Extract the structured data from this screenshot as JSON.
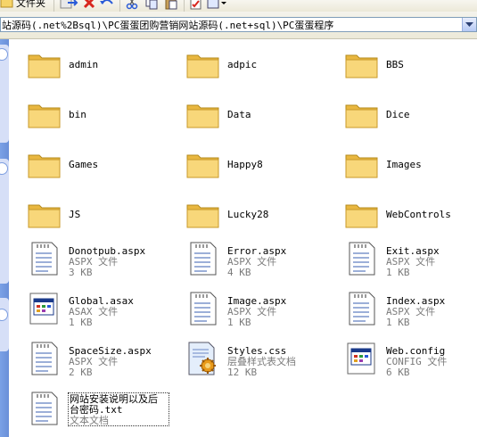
{
  "toolbar": {
    "folders_label": "文件夹"
  },
  "address": {
    "path": "站源码(.net%2Bsql)\\PC蛋蛋团购营销网站源码(.net+sql)\\PC蛋蛋程序"
  },
  "colors": {
    "folder_yellow": "#f6d46a",
    "selection": "#316ac5"
  },
  "folders": [
    {
      "name": "admin"
    },
    {
      "name": "adpic"
    },
    {
      "name": "BBS"
    },
    {
      "name": "bin"
    },
    {
      "name": "Data"
    },
    {
      "name": "Dice"
    },
    {
      "name": "Games"
    },
    {
      "name": "Happy8"
    },
    {
      "name": "Images"
    },
    {
      "name": "JS"
    },
    {
      "name": "Lucky28"
    },
    {
      "name": "WebControls"
    }
  ],
  "files": [
    {
      "name": "Donotpub.aspx",
      "type": "ASPX 文件",
      "size": "3 KB",
      "icon": "aspx-file-icon"
    },
    {
      "name": "Error.aspx",
      "type": "ASPX 文件",
      "size": "4 KB",
      "icon": "aspx-file-icon"
    },
    {
      "name": "Exit.aspx",
      "type": "ASPX 文件",
      "size": "1 KB",
      "icon": "aspx-file-icon"
    },
    {
      "name": "Global.asax",
      "type": "ASAX 文件",
      "size": "1 KB",
      "icon": "asax-file-icon"
    },
    {
      "name": "Image.aspx",
      "type": "ASPX 文件",
      "size": "1 KB",
      "icon": "aspx-file-icon"
    },
    {
      "name": "Index.aspx",
      "type": "ASPX 文件",
      "size": "1 KB",
      "icon": "aspx-file-icon"
    },
    {
      "name": "SpaceSize.aspx",
      "type": "ASPX 文件",
      "size": "2 KB",
      "icon": "aspx-file-icon"
    },
    {
      "name": "Styles.css",
      "type": "层叠样式表文档",
      "size": "12 KB",
      "icon": "css-file-icon"
    },
    {
      "name": "Web.config",
      "type": "CONFIG 文件",
      "size": "6 KB",
      "icon": "config-file-icon"
    },
    {
      "name_line1": "网站安装说明以及后",
      "name_line2": "台密码.txt",
      "type": "文本文档",
      "icon": "txt-file-icon"
    }
  ]
}
